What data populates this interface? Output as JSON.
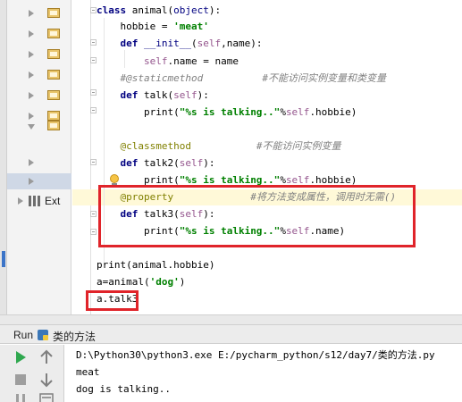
{
  "project_tree": {
    "library_label": "Ext"
  },
  "editor": {
    "lines": [
      {
        "tokens": [
          {
            "t": "class ",
            "c": "kw"
          },
          {
            "t": "animal",
            "c": ""
          },
          {
            "t": "(",
            "c": ""
          },
          {
            "t": "object",
            "c": "builtin"
          },
          {
            "t": "):",
            "c": ""
          }
        ]
      },
      {
        "tokens": [
          {
            "t": "    hobbie = ",
            "c": ""
          },
          {
            "t": "'meat'",
            "c": "str"
          }
        ]
      },
      {
        "tokens": [
          {
            "t": "    ",
            "c": ""
          },
          {
            "t": "def ",
            "c": "kw"
          },
          {
            "t": "__init__",
            "c": "builtin"
          },
          {
            "t": "(",
            "c": ""
          },
          {
            "t": "self",
            "c": "self"
          },
          {
            "t": ",name):",
            "c": ""
          }
        ]
      },
      {
        "tokens": [
          {
            "t": "        ",
            "c": ""
          },
          {
            "t": "self",
            "c": "self"
          },
          {
            "t": ".name = name",
            "c": ""
          }
        ]
      },
      {
        "tokens": [
          {
            "t": "    #@staticmethod          #不能访问实例变量和类变量",
            "c": "comment"
          }
        ]
      },
      {
        "tokens": [
          {
            "t": "    ",
            "c": ""
          },
          {
            "t": "def ",
            "c": "kw"
          },
          {
            "t": "talk(",
            "c": ""
          },
          {
            "t": "self",
            "c": "self"
          },
          {
            "t": "):",
            "c": ""
          }
        ]
      },
      {
        "tokens": [
          {
            "t": "        print(",
            "c": ""
          },
          {
            "t": "\"%s is talking..\"",
            "c": "str"
          },
          {
            "t": "%",
            "c": ""
          },
          {
            "t": "self",
            "c": "self"
          },
          {
            "t": ".hobbie)",
            "c": ""
          }
        ]
      },
      {
        "tokens": []
      },
      {
        "tokens": [
          {
            "t": "    ",
            "c": ""
          },
          {
            "t": "@classmethod",
            "c": "dec"
          },
          {
            "t": "           #不能访问实例变量",
            "c": "comment"
          }
        ]
      },
      {
        "tokens": [
          {
            "t": "    ",
            "c": ""
          },
          {
            "t": "def ",
            "c": "kw"
          },
          {
            "t": "talk2(",
            "c": ""
          },
          {
            "t": "self",
            "c": "self"
          },
          {
            "t": "):",
            "c": ""
          }
        ]
      },
      {
        "tokens": [
          {
            "t": "        print(",
            "c": ""
          },
          {
            "t": "\"%s is talking..\"",
            "c": "str"
          },
          {
            "t": "%",
            "c": ""
          },
          {
            "t": "self",
            "c": "self"
          },
          {
            "t": ".hobbie)",
            "c": ""
          }
        ]
      },
      {
        "tokens": [
          {
            "t": "    ",
            "c": ""
          },
          {
            "t": "@property",
            "c": "dec"
          },
          {
            "t": "             #将方法变成属性，调用时无需()",
            "c": "comment"
          }
        ]
      },
      {
        "tokens": [
          {
            "t": "    ",
            "c": ""
          },
          {
            "t": "def ",
            "c": "kw"
          },
          {
            "t": "talk3(",
            "c": ""
          },
          {
            "t": "self",
            "c": "self"
          },
          {
            "t": "):",
            "c": ""
          }
        ]
      },
      {
        "tokens": [
          {
            "t": "        print(",
            "c": ""
          },
          {
            "t": "\"%s is talking..\"",
            "c": "str"
          },
          {
            "t": "%",
            "c": ""
          },
          {
            "t": "self",
            "c": "self"
          },
          {
            "t": ".name)",
            "c": ""
          }
        ]
      },
      {
        "tokens": []
      },
      {
        "tokens": [
          {
            "t": "print(animal.hobbie)",
            "c": ""
          }
        ]
      },
      {
        "tokens": [
          {
            "t": "a=animal(",
            "c": ""
          },
          {
            "t": "'dog'",
            "c": "str"
          },
          {
            "t": ")",
            "c": ""
          }
        ]
      },
      {
        "tokens": [
          {
            "t": "a.talk3",
            "c": ""
          }
        ]
      }
    ]
  },
  "run_panel": {
    "title": "Run",
    "config_name": "类的方法",
    "output": [
      "D:\\Python30\\python3.exe E:/pycharm_python/s12/day7/类的方法.py",
      "meat",
      "dog is talking.."
    ]
  },
  "colors": {
    "keyword": "#000080",
    "string": "#008000",
    "self": "#94558d",
    "decorator": "#808000",
    "comment": "#808080",
    "annotation_box": "#e0242a",
    "run_icon": "#2fa84f"
  }
}
